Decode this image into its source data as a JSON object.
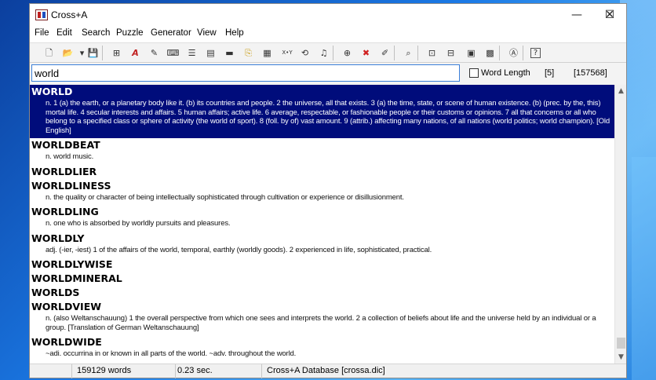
{
  "window": {
    "title": "Cross+A"
  },
  "menu": [
    "File",
    "Edit",
    "Search",
    "Puzzle",
    "Generator",
    "View",
    "Help"
  ],
  "toolbar": {
    "icons": [
      {
        "name": "new-icon",
        "glyph": "🗋"
      },
      {
        "name": "open-icon",
        "glyph": "📂"
      },
      {
        "name": "dropdown-icon",
        "glyph": "▾"
      },
      {
        "name": "save-icon",
        "glyph": "💾"
      },
      {
        "name": "grid-link-icon",
        "glyph": "⊞"
      },
      {
        "name": "font-icon",
        "glyph": "A"
      },
      {
        "name": "find-word-icon",
        "glyph": "✎"
      },
      {
        "name": "fill-icon",
        "glyph": "⌨"
      },
      {
        "name": "clues-icon",
        "glyph": "☰"
      },
      {
        "name": "list-icon",
        "glyph": "▤"
      },
      {
        "name": "flag-icon",
        "glyph": "▬"
      },
      {
        "name": "keys-icon",
        "glyph": "⎘"
      },
      {
        "name": "grid-icon",
        "glyph": "▦"
      },
      {
        "name": "xy-icon",
        "glyph": "X•Y"
      },
      {
        "name": "rotate-icon",
        "glyph": "⟲"
      },
      {
        "name": "music-icon",
        "glyph": "♫"
      },
      {
        "name": "add-icon",
        "glyph": "⊕"
      },
      {
        "name": "delete-icon",
        "glyph": "✖"
      },
      {
        "name": "edit-icon",
        "glyph": "✐"
      },
      {
        "name": "search-icon",
        "glyph": "⌕"
      },
      {
        "name": "grid-a-icon",
        "glyph": "⊡"
      },
      {
        "name": "grid-b-icon",
        "glyph": "⊟"
      },
      {
        "name": "grid-c-icon",
        "glyph": "▣"
      },
      {
        "name": "grid-d-icon",
        "glyph": "▩"
      },
      {
        "name": "abc-icon",
        "glyph": "Ⓐ"
      },
      {
        "name": "help-icon",
        "glyph": "?"
      }
    ]
  },
  "search": {
    "value": "world"
  },
  "word_length": {
    "label": "Word Length",
    "checked": false
  },
  "counts": {
    "matches": "[5]",
    "total": "[157568]"
  },
  "entries": [
    {
      "word": "WORLD",
      "def": "n. 1 (a) the earth, or a planetary body like it. (b) its countries and people. 2 the universe, all that exists. 3 (a) the time, state, or scene of human existence. (b) (prec. by the, this) mortal life. 4 secular interests and affairs. 5 human affairs; active life. 6 average, respectable, or fashionable people or their customs or opinions. 7 all that concerns or all who belong to a specified class or sphere of activity (the world of sport). 8 (foll. by of) vast amount. 9 (attrib.) affecting many nations, of all nations (world politics; world champion). [Old English]",
      "selected": true
    },
    {
      "word": "WORLDBEAT",
      "def": "n. world music."
    },
    {
      "word": "WORLDLIER",
      "def": ""
    },
    {
      "word": "WORLDLINESS",
      "def": "n. the quality or character of being intellectually sophisticated through cultivation or experience or disillusionment."
    },
    {
      "word": "WORLDLING",
      "def": "n. one who is absorbed by worldly pursuits and pleasures."
    },
    {
      "word": "WORLDLY",
      "def": "adj. (-ier, -iest) 1 of the affairs of the world, temporal, earthly (worldly goods). 2 experienced in life, sophisticated, practical."
    },
    {
      "word": "WORLDLYWISE",
      "def": ""
    },
    {
      "word": "WORLDMINERAL",
      "def": ""
    },
    {
      "word": "WORLDS",
      "def": ""
    },
    {
      "word": "WORLDVIEW",
      "def": "n. (also Weltanschauung) 1 the overall perspective from which one sees and interprets the world. 2 a collection of beliefs about life and the universe held by an individual or a group. [Translation of German Weltanschauung]"
    },
    {
      "word": "WORLDWIDE",
      "def": "~adi. occurrina in or known in all parts of the world. ~adv. throughout the world."
    }
  ],
  "status": {
    "words": "159129 words",
    "time": "0.23 sec.",
    "database": "Cross+A Database [crossa.dic]"
  }
}
